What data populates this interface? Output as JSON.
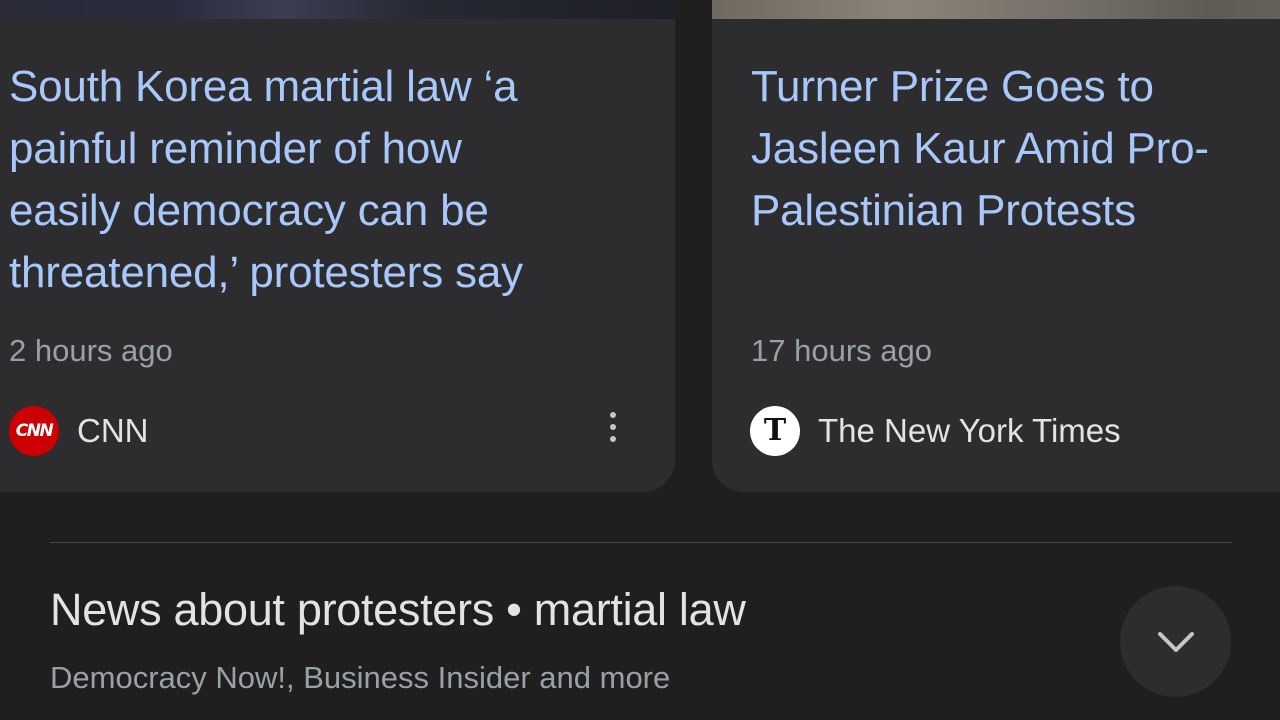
{
  "cards": [
    {
      "headline_lines": [
        "South Korea martial law ‘a",
        "painful reminder of how",
        "easily democracy can be",
        "threatened,’ protesters say"
      ],
      "time": "2 hours ago",
      "source": "CNN",
      "logo_text": "CNN",
      "logo_color": "#cc0000"
    },
    {
      "headline_lines": [
        "Turner Prize Goes to",
        "Jasleen Kaur Amid Pro-",
        "Palestinian Protests"
      ],
      "time": "17 hours ago",
      "source": "The New York Times",
      "logo_text": "T",
      "logo_color": "#ffffff"
    }
  ],
  "section": {
    "title": "News about protesters • martial law",
    "subtitle": "Democracy Now!, Business Insider and more"
  },
  "colors": {
    "background": "#1f1f1f",
    "card": "#2d2d30",
    "headline": "#a8c7fa",
    "muted": "#9aa0a6",
    "text": "#e3e3e3"
  },
  "icons": {
    "more": "more-vert-icon",
    "expand": "chevron-down-icon"
  }
}
